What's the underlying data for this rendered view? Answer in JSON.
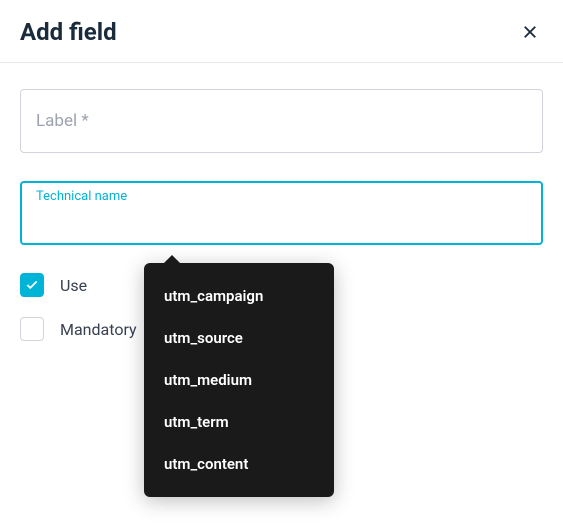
{
  "dialog": {
    "title": "Add field"
  },
  "fields": {
    "label": {
      "placeholder": "Label *",
      "value": ""
    },
    "technicalName": {
      "floatingLabel": "Technical name",
      "value": ""
    }
  },
  "checkboxes": {
    "use": {
      "label": "Use",
      "checked": true
    },
    "mandatory": {
      "label": "Mandatory",
      "checked": false
    }
  },
  "dropdown": {
    "items": [
      "utm_campaign",
      "utm_source",
      "utm_medium",
      "utm_term",
      "utm_content"
    ]
  },
  "colors": {
    "accent": "#00b4d8",
    "text": "#1a2b3c"
  }
}
